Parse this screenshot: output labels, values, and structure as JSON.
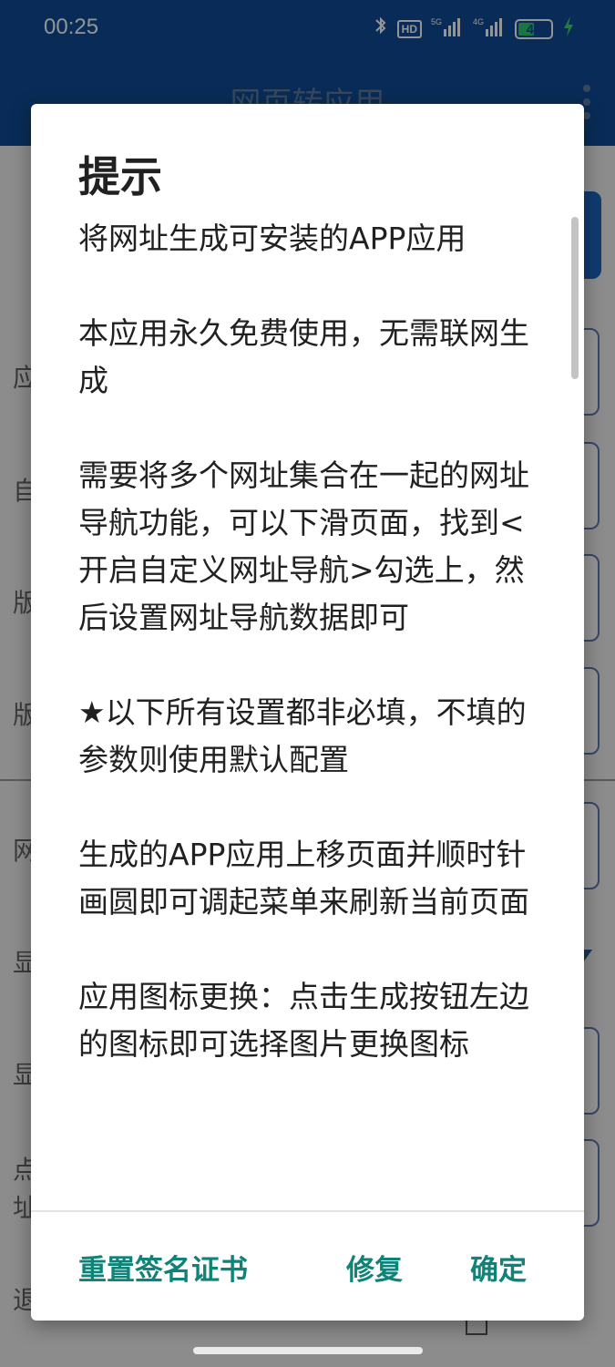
{
  "status_bar": {
    "time": "00:25",
    "icons": [
      "bluetooth-icon",
      "hd-voice-icon",
      "5g-signal-icon",
      "4g-signal-icon",
      "battery-icon",
      "charging-icon"
    ],
    "hd_label": "HD",
    "battery_level": "46"
  },
  "app": {
    "title": "网页转应用",
    "peek_labels": [
      "应",
      "自",
      "版",
      "版",
      "网",
      "显",
      "显",
      "点",
      "址",
      "退"
    ]
  },
  "dialog": {
    "title": "提示",
    "paragraphs": [
      "将网址生成可安装的APP应用",
      "本应用永久免费使用，无需联网生成",
      "需要将多个网址集合在一起的网址导航功能，可以下滑页面，找到<开启自定义网址导航>勾选上，然后设置网址导航数据即可",
      "★以下所有设置都非必填，不填的参数则使用默认配置",
      "生成的APP应用上移页面并顺时针画圆即可调起菜单来刷新当前页面",
      "应用图标更换：点击生成按钮左边的图标即可选择图片更换图标"
    ],
    "buttons": {
      "reset_cert": "重置签名证书",
      "repair": "修复",
      "confirm": "确定"
    }
  },
  "colors": {
    "primary": "#0e4c97",
    "accent": "#0f8377",
    "battery_green": "#2ecc71"
  }
}
